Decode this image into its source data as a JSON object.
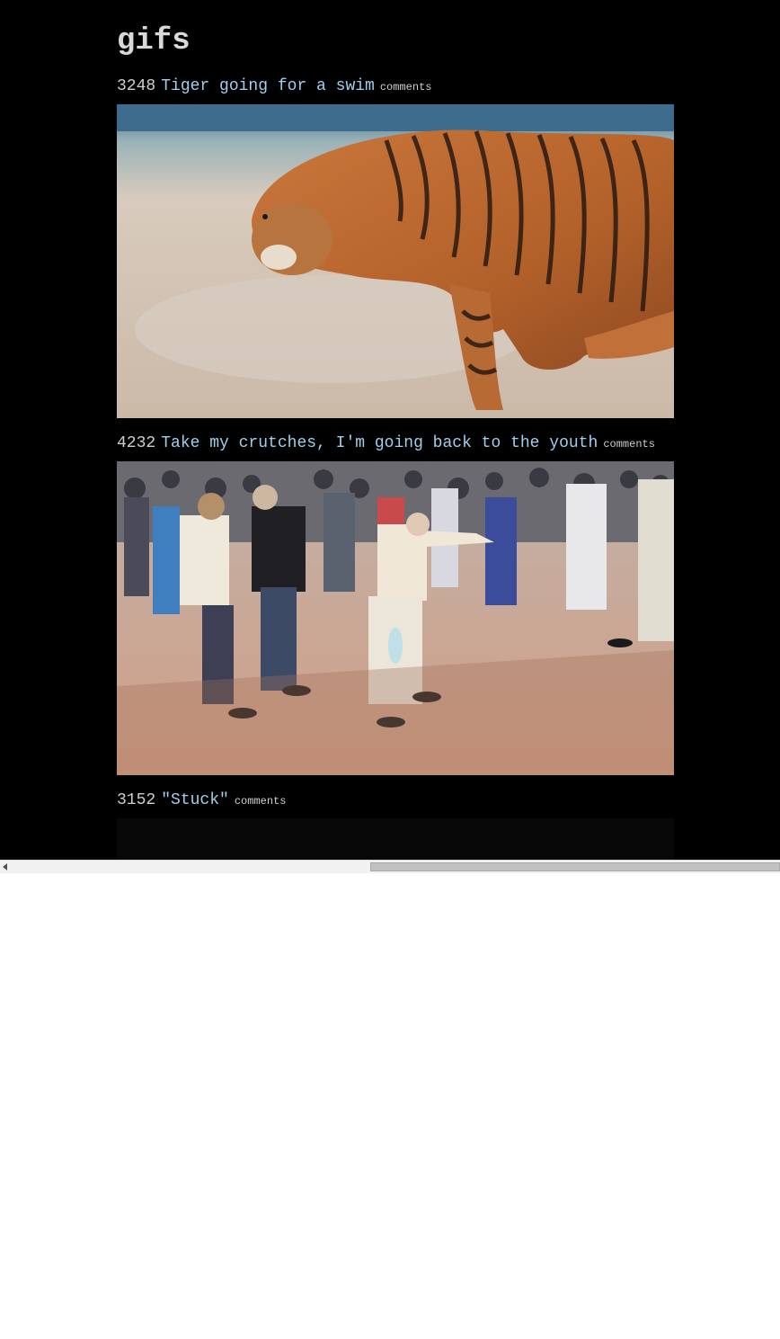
{
  "site": {
    "title": "gifs"
  },
  "posts": [
    {
      "score": "3248",
      "title": "Tiger going for a swim",
      "comments_label": "comments",
      "media_subject": "tiger-swimming"
    },
    {
      "score": "4232",
      "title": "Take my crutches, I'm going back to the youth",
      "comments_label": "comments",
      "media_subject": "elderly-people-dancing"
    },
    {
      "score": "3152",
      "title": "\"Stuck\"",
      "comments_label": "comments",
      "media_subject": "dark-scene"
    }
  ],
  "colors": {
    "page_background": "#000000",
    "title_text": "#d9d9d9",
    "link": "#9fd0ee",
    "score_text": "#cfcfcf"
  },
  "scrollbar": {
    "orientation": "horizontal",
    "left_arrow_icon": "triangle-left-icon"
  }
}
